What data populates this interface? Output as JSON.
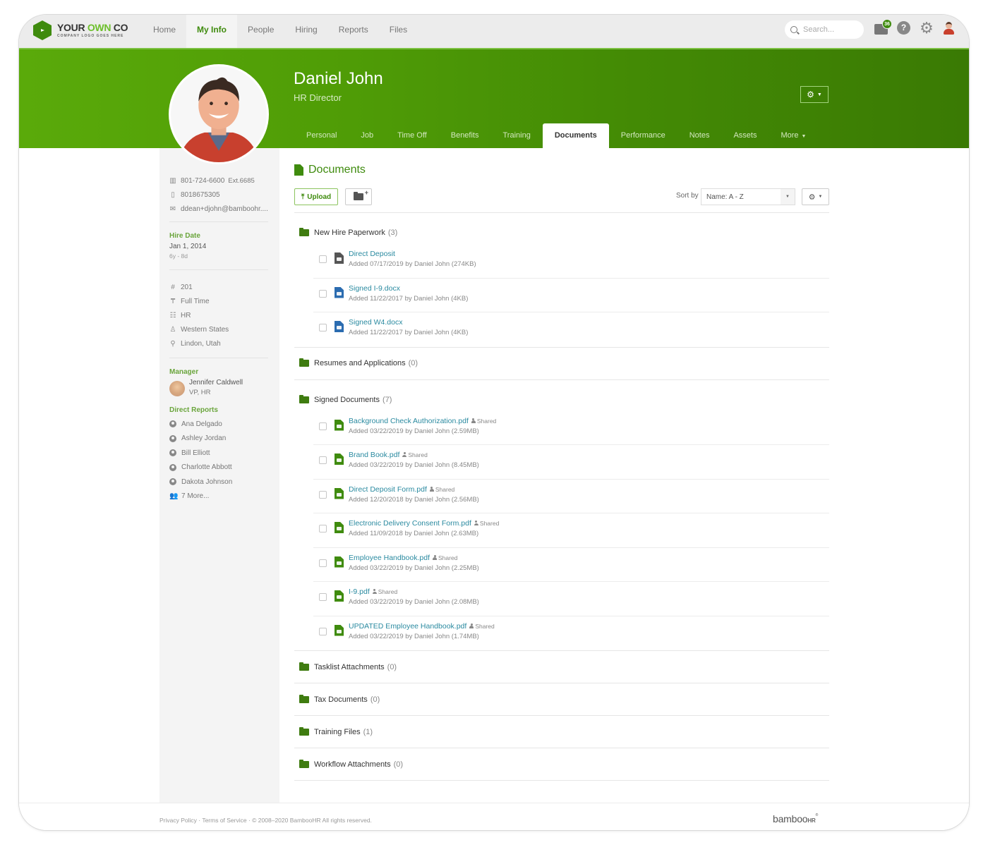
{
  "brand": {
    "logo_main_1": "YOUR ",
    "logo_main_2": "OWN",
    "logo_main_3": " CO",
    "logo_sub": "COMPANY LOGO GOES HERE",
    "accent": "#3f8b0e",
    "header_green": "#4f9c06"
  },
  "topnav": {
    "links": [
      {
        "label": "Home",
        "active": false
      },
      {
        "label": "My Info",
        "active": true
      },
      {
        "label": "People",
        "active": false
      },
      {
        "label": "Hiring",
        "active": false
      },
      {
        "label": "Reports",
        "active": false
      },
      {
        "label": "Files",
        "active": false
      }
    ],
    "search_placeholder": "Search...",
    "inbox_badge": "36",
    "help_glyph": "?",
    "icons": [
      "inbox-icon",
      "help-icon",
      "gear-icon",
      "user-avatar-icon"
    ]
  },
  "employee": {
    "name": "Daniel John",
    "title": "HR Director"
  },
  "tabs": [
    {
      "label": "Personal",
      "active": false
    },
    {
      "label": "Job",
      "active": false
    },
    {
      "label": "Time Off",
      "active": false
    },
    {
      "label": "Benefits",
      "active": false
    },
    {
      "label": "Training",
      "active": false
    },
    {
      "label": "Documents",
      "active": true
    },
    {
      "label": "Performance",
      "active": false
    },
    {
      "label": "Notes",
      "active": false
    },
    {
      "label": "Assets",
      "active": false
    },
    {
      "label": "More",
      "active": false,
      "dropdown": true
    }
  ],
  "sidebar": {
    "work_phone": "801-724-6600",
    "ext": "Ext.6685",
    "mobile": "8018675305",
    "email": "ddean+djohn@bamboohr....",
    "hire_date_label": "Hire Date",
    "hire_date": "Jan 1, 2014",
    "tenure": "6y - 8d",
    "employee_number": "201",
    "employment_type": "Full Time",
    "department": "HR",
    "division": "Western States",
    "location": "Lindon, Utah",
    "manager_label": "Manager",
    "manager_name": "Jennifer Caldwell",
    "manager_title": "VP, HR",
    "direct_reports_label": "Direct Reports",
    "direct_reports": [
      "Ana Delgado",
      "Ashley Jordan",
      "Bill Elliott",
      "Charlotte Abbott",
      "Dakota Johnson"
    ],
    "more_reports": "7 More..."
  },
  "documents": {
    "title": "Documents",
    "upload_label": "Upload",
    "sort_label": "Sort by",
    "sort_value": "Name: A - Z",
    "folders": [
      {
        "name": "New Hire Paperwork",
        "count": "(3)",
        "open": true,
        "files": [
          {
            "name": "Direct Deposit",
            "type": "gray",
            "shared": false,
            "meta": "Added 07/17/2019 by Daniel John (274KB)"
          },
          {
            "name": "Signed I-9.docx",
            "type": "blue",
            "shared": false,
            "meta": "Added 11/22/2017 by Daniel John (4KB)"
          },
          {
            "name": "Signed W4.docx",
            "type": "blue",
            "shared": false,
            "meta": "Added 11/22/2017 by Daniel John (4KB)"
          }
        ]
      },
      {
        "name": "Resumes and Applications",
        "count": "(0)",
        "open": false,
        "files": []
      },
      {
        "name": "Signed Documents",
        "count": "(7)",
        "open": true,
        "files": [
          {
            "name": "Background Check Authorization.pdf",
            "type": "green",
            "shared": true,
            "meta": "Added 03/22/2019 by Daniel John (2.59MB)"
          },
          {
            "name": "Brand Book.pdf",
            "type": "green",
            "shared": true,
            "meta": "Added 03/22/2019 by Daniel John (8.45MB)"
          },
          {
            "name": "Direct Deposit Form.pdf",
            "type": "green",
            "shared": true,
            "meta": "Added 12/20/2018 by Daniel John (2.56MB)"
          },
          {
            "name": "Electronic Delivery Consent Form.pdf",
            "type": "green",
            "shared": true,
            "meta": "Added 11/09/2018 by Daniel John (2.63MB)"
          },
          {
            "name": "Employee Handbook.pdf",
            "type": "green",
            "shared": true,
            "meta": "Added 03/22/2019 by Daniel John (2.25MB)"
          },
          {
            "name": "I-9.pdf",
            "type": "green",
            "shared": true,
            "meta": "Added 03/22/2019 by Daniel John (2.08MB)"
          },
          {
            "name": "UPDATED Employee Handbook.pdf",
            "type": "green",
            "shared": true,
            "meta": "Added 03/22/2019 by Daniel John (1.74MB)"
          }
        ]
      },
      {
        "name": "Tasklist Attachments",
        "count": "(0)",
        "open": false,
        "files": []
      },
      {
        "name": "Tax Documents",
        "count": "(0)",
        "open": false,
        "files": []
      },
      {
        "name": "Training Files",
        "count": "(1)",
        "open": false,
        "files": []
      },
      {
        "name": "Workflow Attachments",
        "count": "(0)",
        "open": false,
        "files": []
      }
    ],
    "shared_label": "Shared"
  },
  "footer": {
    "privacy": "Privacy Policy",
    "terms": "Terms of Service",
    "copyright": "· © 2008–2020 BambooHR All rights reserved.",
    "separator": " · ",
    "brand_main": "bamboo",
    "brand_hr": "HR"
  }
}
